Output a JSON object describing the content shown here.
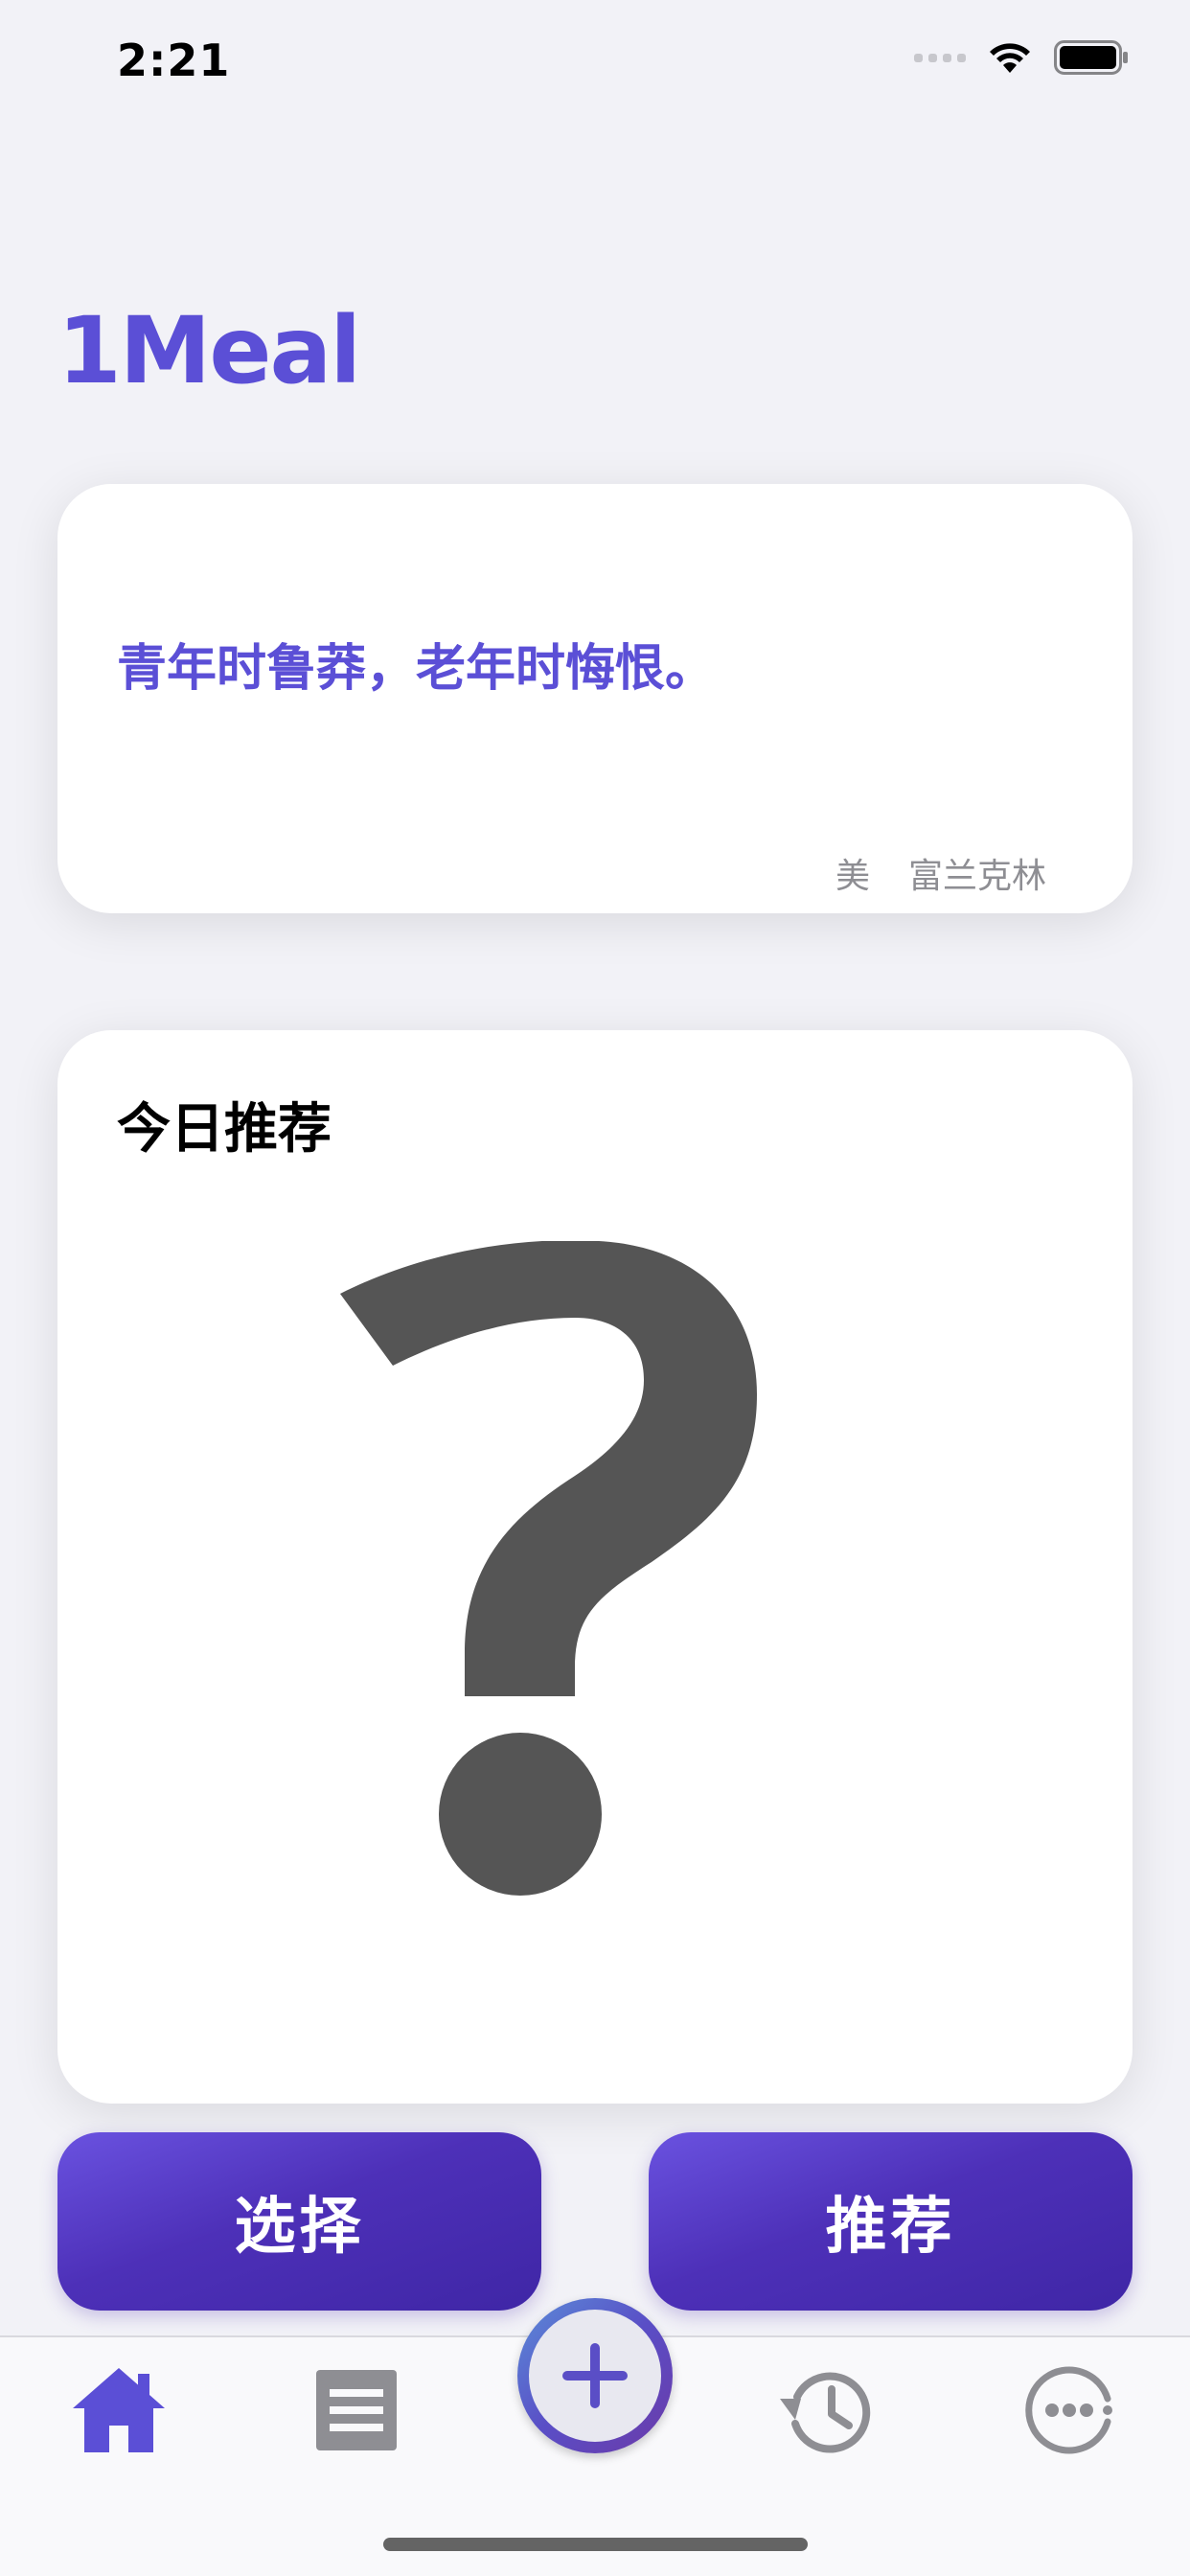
{
  "status_bar": {
    "time": "2:21",
    "icons": [
      "signal-icon",
      "wifi-icon",
      "battery-icon"
    ]
  },
  "app": {
    "title": "1Meal",
    "accent_color": "#5b4fd6"
  },
  "quote": {
    "text": "青年时鲁莽，老年时悔恨。",
    "author_country": "美",
    "author_name": "富兰克林"
  },
  "recommendation": {
    "title": "今日推荐",
    "placeholder_icon": "question-mark-icon"
  },
  "actions": {
    "choose_label": "选择",
    "recommend_label": "推荐"
  },
  "tab_bar": {
    "items": [
      {
        "icon": "home-icon",
        "active": true
      },
      {
        "icon": "list-icon",
        "active": false
      },
      {
        "icon": "add-icon",
        "active": false
      },
      {
        "icon": "history-icon",
        "active": false
      },
      {
        "icon": "more-icon",
        "active": false
      }
    ]
  }
}
